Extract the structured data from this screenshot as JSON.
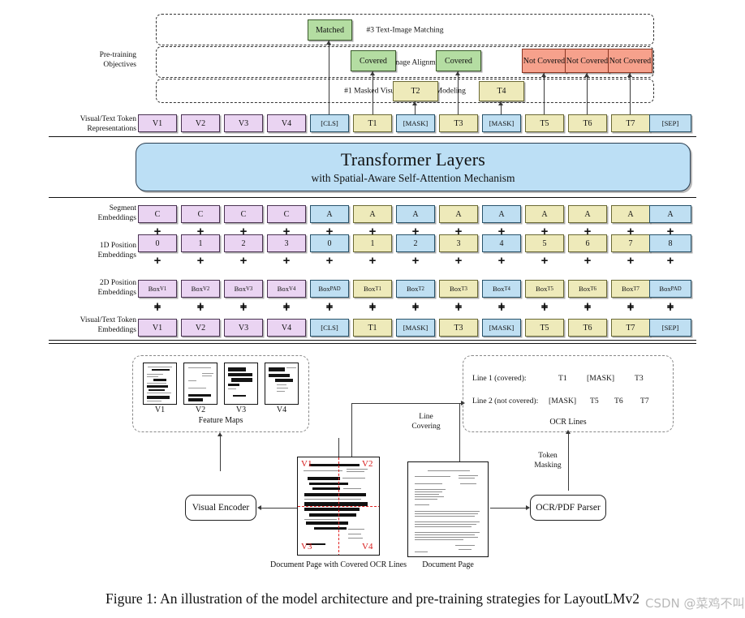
{
  "figure": {
    "caption": "Figure 1: An illustration of the model architecture and pre-training strategies for LayoutLMv2",
    "watermark": "CSDN @菜鸡不叫"
  },
  "row_labels": {
    "pretraining_objectives": "Pre-training\nObjectives",
    "token_representations": "Visual/Text Token\nRepresentations",
    "segment_embeddings": "Segment\nEmbeddings",
    "pos1d_embeddings": "1D Position\nEmbeddings",
    "pos2d_embeddings": "2D Position\nEmbeddings",
    "token_embeddings": "Visual/Text Token\nEmbeddings"
  },
  "objectives": [
    {
      "id": "tim",
      "label": "#3 Text-Image Matching"
    },
    {
      "id": "tia",
      "label": "#2 Text-Image Alignment"
    },
    {
      "id": "mvlm",
      "label": "#1 Masked Visual-Language Modeling"
    }
  ],
  "objective_outputs": {
    "matching": [
      {
        "label": "Matched",
        "color": "green",
        "col": 4
      }
    ],
    "alignment": [
      {
        "label": "Covered",
        "color": "green",
        "col": 5
      },
      {
        "label": "Covered",
        "color": "green",
        "col": 7
      },
      {
        "label": "Not\nCovered",
        "color": "red",
        "col": 9
      },
      {
        "label": "Not\nCovered",
        "color": "red",
        "col": 10
      },
      {
        "label": "Not\nCovered",
        "color": "red",
        "col": 11
      }
    ],
    "mvlm": [
      {
        "label": "T2",
        "color": "yellow",
        "col": 6
      },
      {
        "label": "T4",
        "color": "yellow",
        "col": 8
      }
    ]
  },
  "transformer": {
    "title": "Transformer Layers",
    "subtitle": "with Spatial-Aware Self-Attention Mechanism"
  },
  "columns": [
    {
      "token": "V1",
      "segment": "C",
      "pos1d": "0",
      "box": "Box",
      "box_sub": "V1",
      "color": "purple"
    },
    {
      "token": "V2",
      "segment": "C",
      "pos1d": "1",
      "box": "Box",
      "box_sub": "V2",
      "color": "purple"
    },
    {
      "token": "V3",
      "segment": "C",
      "pos1d": "2",
      "box": "Box",
      "box_sub": "V3",
      "color": "purple"
    },
    {
      "token": "V4",
      "segment": "C",
      "pos1d": "3",
      "box": "Box",
      "box_sub": "V4",
      "color": "purple"
    },
    {
      "token": "[CLS]",
      "segment": "A",
      "pos1d": "0",
      "box": "Box",
      "box_sub": "PAD",
      "color": "blue"
    },
    {
      "token": "T1",
      "segment": "A",
      "pos1d": "1",
      "box": "Box",
      "box_sub": "T1",
      "color": "yellow"
    },
    {
      "token": "[MASK]",
      "segment": "A",
      "pos1d": "2",
      "box": "Box",
      "box_sub": "T2",
      "color": "blue"
    },
    {
      "token": "T3",
      "segment": "A",
      "pos1d": "3",
      "box": "Box",
      "box_sub": "T3",
      "color": "yellow"
    },
    {
      "token": "[MASK]",
      "segment": "A",
      "pos1d": "4",
      "box": "Box",
      "box_sub": "T4",
      "color": "blue"
    },
    {
      "token": "T5",
      "segment": "A",
      "pos1d": "5",
      "box": "Box",
      "box_sub": "T5",
      "color": "yellow"
    },
    {
      "token": "T6",
      "segment": "A",
      "pos1d": "6",
      "box": "Box",
      "box_sub": "T6",
      "color": "yellow"
    },
    {
      "token": "T7",
      "segment": "A",
      "pos1d": "7",
      "box": "Box",
      "box_sub": "T7",
      "color": "yellow"
    },
    {
      "token": "[SEP]",
      "segment": "A",
      "pos1d": "8",
      "box": "Box",
      "box_sub": "PAD",
      "color": "blue"
    }
  ],
  "plus_symbol": "+",
  "bottom": {
    "feature_maps": {
      "caption": "Feature Maps",
      "items": [
        "V1",
        "V2",
        "V3",
        "V4"
      ]
    },
    "ocr_lines": {
      "caption": "OCR Lines",
      "line1_label": "Line 1 (covered):",
      "line1_tokens": [
        "T1",
        "[MASK]",
        "T3"
      ],
      "line2_label": "Line 2 (not covered):",
      "line2_tokens": [
        "[MASK]",
        "T5",
        "T6",
        "T7"
      ]
    },
    "visual_encoder": "Visual Encoder",
    "ocr_parser": "OCR/PDF Parser",
    "line_covering": "Line\nCovering",
    "token_masking": "Token\nMasking",
    "covered_doc_caption": "Document Page with Covered OCR Lines",
    "doc_caption": "Document Page",
    "covered_doc_corners": [
      "V1",
      "V2",
      "V3",
      "V4"
    ]
  }
}
